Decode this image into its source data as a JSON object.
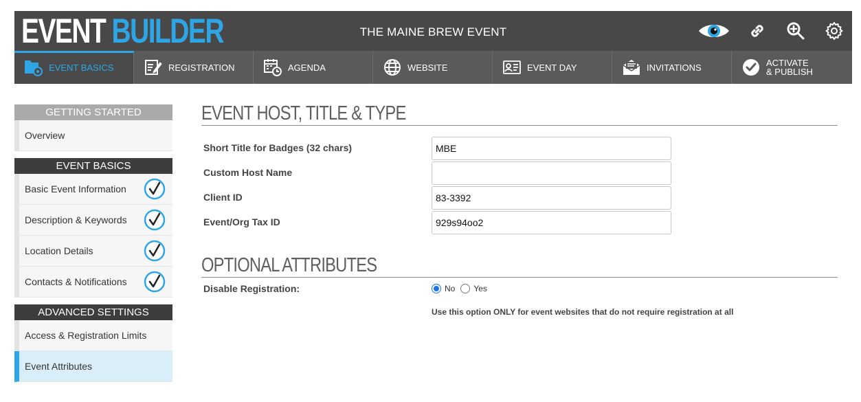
{
  "header": {
    "logo_part1": "EVENT",
    "logo_part2": "BUILDER",
    "event_title": "THE MAINE BREW EVENT",
    "icons": [
      "eye-icon",
      "link-icon",
      "zoom-in-icon",
      "gear-icon"
    ]
  },
  "nav": {
    "items": [
      {
        "label": "EVENT BASICS",
        "icon": "event-basics-icon",
        "active": true
      },
      {
        "label": "REGISTRATION",
        "icon": "registration-icon"
      },
      {
        "label": "AGENDA",
        "icon": "agenda-icon"
      },
      {
        "label": "WEBSITE",
        "icon": "globe-icon"
      },
      {
        "label": "EVENT DAY",
        "icon": "badge-icon"
      },
      {
        "label": "INVITATIONS",
        "icon": "envelope-icon"
      },
      {
        "label_line1": "ACTIVATE",
        "label_line2": "& PUBLISH",
        "icon": "checkmark-icon"
      }
    ]
  },
  "sidebar": {
    "sections": [
      {
        "title": "GETTING STARTED",
        "items": [
          {
            "label": "Overview"
          }
        ]
      },
      {
        "title": "EVENT BASICS",
        "items": [
          {
            "label": "Basic Event Information",
            "checked": true
          },
          {
            "label": "Description & Keywords",
            "checked": true
          },
          {
            "label": "Location Details",
            "checked": true
          },
          {
            "label": "Contacts & Notifications",
            "checked": true
          }
        ]
      },
      {
        "title": "ADVANCED SETTINGS",
        "items": [
          {
            "label": "Access & Registration Limits"
          },
          {
            "label": "Event Attributes",
            "active": true
          }
        ]
      }
    ]
  },
  "main": {
    "section1_title": "EVENT HOST, TITLE & TYPE",
    "fields": [
      {
        "label": "Short Title for Badges (32 chars)",
        "value": "MBE"
      },
      {
        "label": "Custom Host Name",
        "value": ""
      },
      {
        "label": "Client ID",
        "value": "83-3392"
      },
      {
        "label": "Event/Org Tax ID",
        "value": "929s94oo2"
      }
    ],
    "section2_title": "OPTIONAL ATTRIBUTES",
    "disable_registration": {
      "label": "Disable Registration:",
      "option_no": "No",
      "option_yes": "Yes",
      "selected": "No",
      "help": "Use this option ONLY for event websites that do not require registration at all"
    }
  },
  "colors": {
    "accent": "#2ea6e6",
    "header_bg": "#484848",
    "nav_bg": "#5a5a5a",
    "active_sidebar_bg": "#daeefa"
  }
}
